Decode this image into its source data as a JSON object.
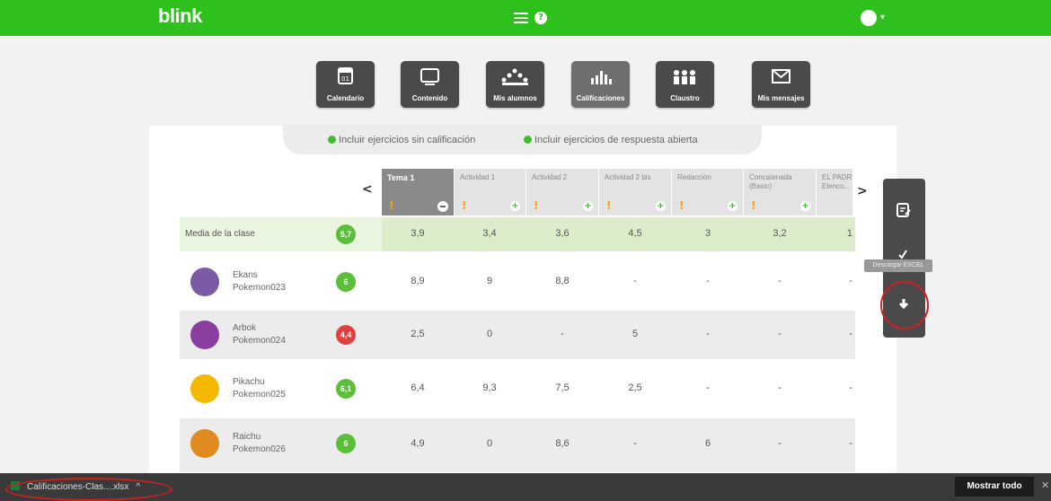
{
  "app": {
    "logo": "blink"
  },
  "nav": [
    {
      "label": "Calendario",
      "icon": "calendar-icon"
    },
    {
      "label": "Contenido",
      "icon": "monitor-icon"
    },
    {
      "label": "Mis alumnos",
      "icon": "students-icon"
    },
    {
      "label": "Calificaciones",
      "icon": "bar-chart-icon",
      "active": true
    },
    {
      "label": "Claustro",
      "icon": "staff-icon"
    },
    {
      "label": "Mis mensajes",
      "icon": "envelope-icon"
    }
  ],
  "filters": {
    "f1": "Incluir ejercicios sin calificación",
    "f2": "Incluir ejercicios de respuesta abierta"
  },
  "columns": [
    {
      "title": "Tema 1"
    },
    {
      "title": "Actividad 1"
    },
    {
      "title": "Actividad 2"
    },
    {
      "title": "Actividad 2 bis"
    },
    {
      "title": "Redacción"
    },
    {
      "title": "Concatenada (Basic)"
    },
    {
      "title": "EL PADR Elenco..."
    }
  ],
  "average": {
    "label": "Media de la clase",
    "score": "5,7",
    "values": [
      "3,9",
      "3,4",
      "3,6",
      "4,5",
      "3",
      "3,2",
      "1"
    ]
  },
  "students": [
    {
      "name": "Ekans",
      "user": "Pokemon023",
      "score": "6",
      "score_color": "#5cbf3a",
      "values": [
        "8,9",
        "9",
        "8,8",
        "-",
        "-",
        "-",
        "-"
      ],
      "avatar_color": "#7b5aa6"
    },
    {
      "name": "Arbok",
      "user": "Pokemon024",
      "score": "4,4",
      "score_color": "#e04040",
      "values": [
        "2,5",
        "0",
        "-",
        "5",
        "-",
        "-",
        "-"
      ],
      "avatar_color": "#8a3fa0"
    },
    {
      "name": "Pikachu",
      "user": "Pokemon025",
      "score": "6,1",
      "score_color": "#5cbf3a",
      "values": [
        "6,4",
        "9,3",
        "7,5",
        "2,5",
        "-",
        "-",
        "-"
      ],
      "avatar_color": "#f5b800"
    },
    {
      "name": "Raichu",
      "user": "Pokemon026",
      "score": "6",
      "score_color": "#5cbf3a",
      "values": [
        "4,9",
        "0",
        "8,6",
        "-",
        "6",
        "-",
        "-"
      ],
      "avatar_color": "#e08a20"
    }
  ],
  "side": {
    "tooltip": "Descargar EXCEL"
  },
  "download": {
    "file": "Calificaciones-Clas....xlsx",
    "show_all": "Mostrar todo"
  }
}
